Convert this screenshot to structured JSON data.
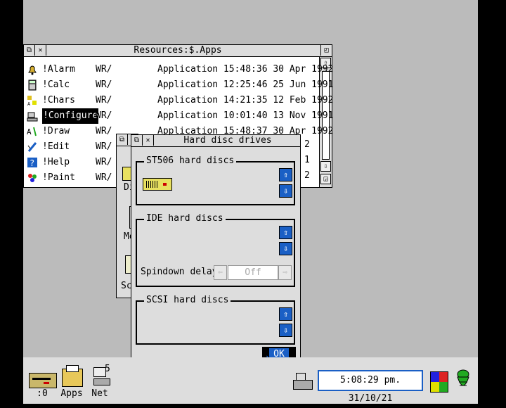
{
  "apps_window": {
    "title": "Resources:$.Apps",
    "rows": [
      {
        "name": "!Alarm",
        "access": "WR/",
        "type": "Application 15:48:36 30 Apr 1992",
        "icon": "bell-icon",
        "selected": false
      },
      {
        "name": "!Calc",
        "access": "WR/",
        "type": "Application 12:25:46 25 Jun 1991",
        "icon": "calculator-icon",
        "selected": false
      },
      {
        "name": "!Chars",
        "access": "WR/",
        "type": "Application 14:21:35 12 Feb 1992",
        "icon": "chars-icon",
        "selected": false
      },
      {
        "name": "!Configure",
        "access": "WR/",
        "type": "Application 10:01:40 13 Nov 1991",
        "icon": "configure-icon",
        "selected": true
      },
      {
        "name": "!Draw",
        "access": "WR/",
        "type": "Application 15:48:37 30 Apr 1992",
        "icon": "draw-icon",
        "selected": false
      },
      {
        "name": "!Edit",
        "access": "WR/",
        "type": "",
        "icon": "edit-icon",
        "selected": false
      },
      {
        "name": "!Help",
        "access": "WR/",
        "type": "",
        "icon": "help-icon",
        "selected": false
      },
      {
        "name": "!Paint",
        "access": "WR/",
        "type": "",
        "icon": "paint-icon",
        "selected": false
      }
    ],
    "partial_right": [
      "2",
      "1",
      "2"
    ]
  },
  "config_window": {
    "partial_labels": [
      "Di",
      "Me",
      "Sc"
    ]
  },
  "hdd_dialog": {
    "title": "Hard disc drives",
    "st506_label": "ST506 hard discs",
    "ide_label": "IDE hard discs",
    "spindown_label": "Spindown delay",
    "spindown_value": "Off",
    "scsi_label": "SCSI hard discs",
    "ok_label": "OK"
  },
  "iconbar": {
    "drive_label": ":0",
    "apps_label": "Apps",
    "net_label": "Net",
    "net_number": "5",
    "clock": "5:08:29 pm. 31/10/21"
  },
  "colors": {
    "desktop": "#bbbbbb",
    "accent_blue": "#1a5fc5",
    "window_grey": "#dddddd"
  }
}
